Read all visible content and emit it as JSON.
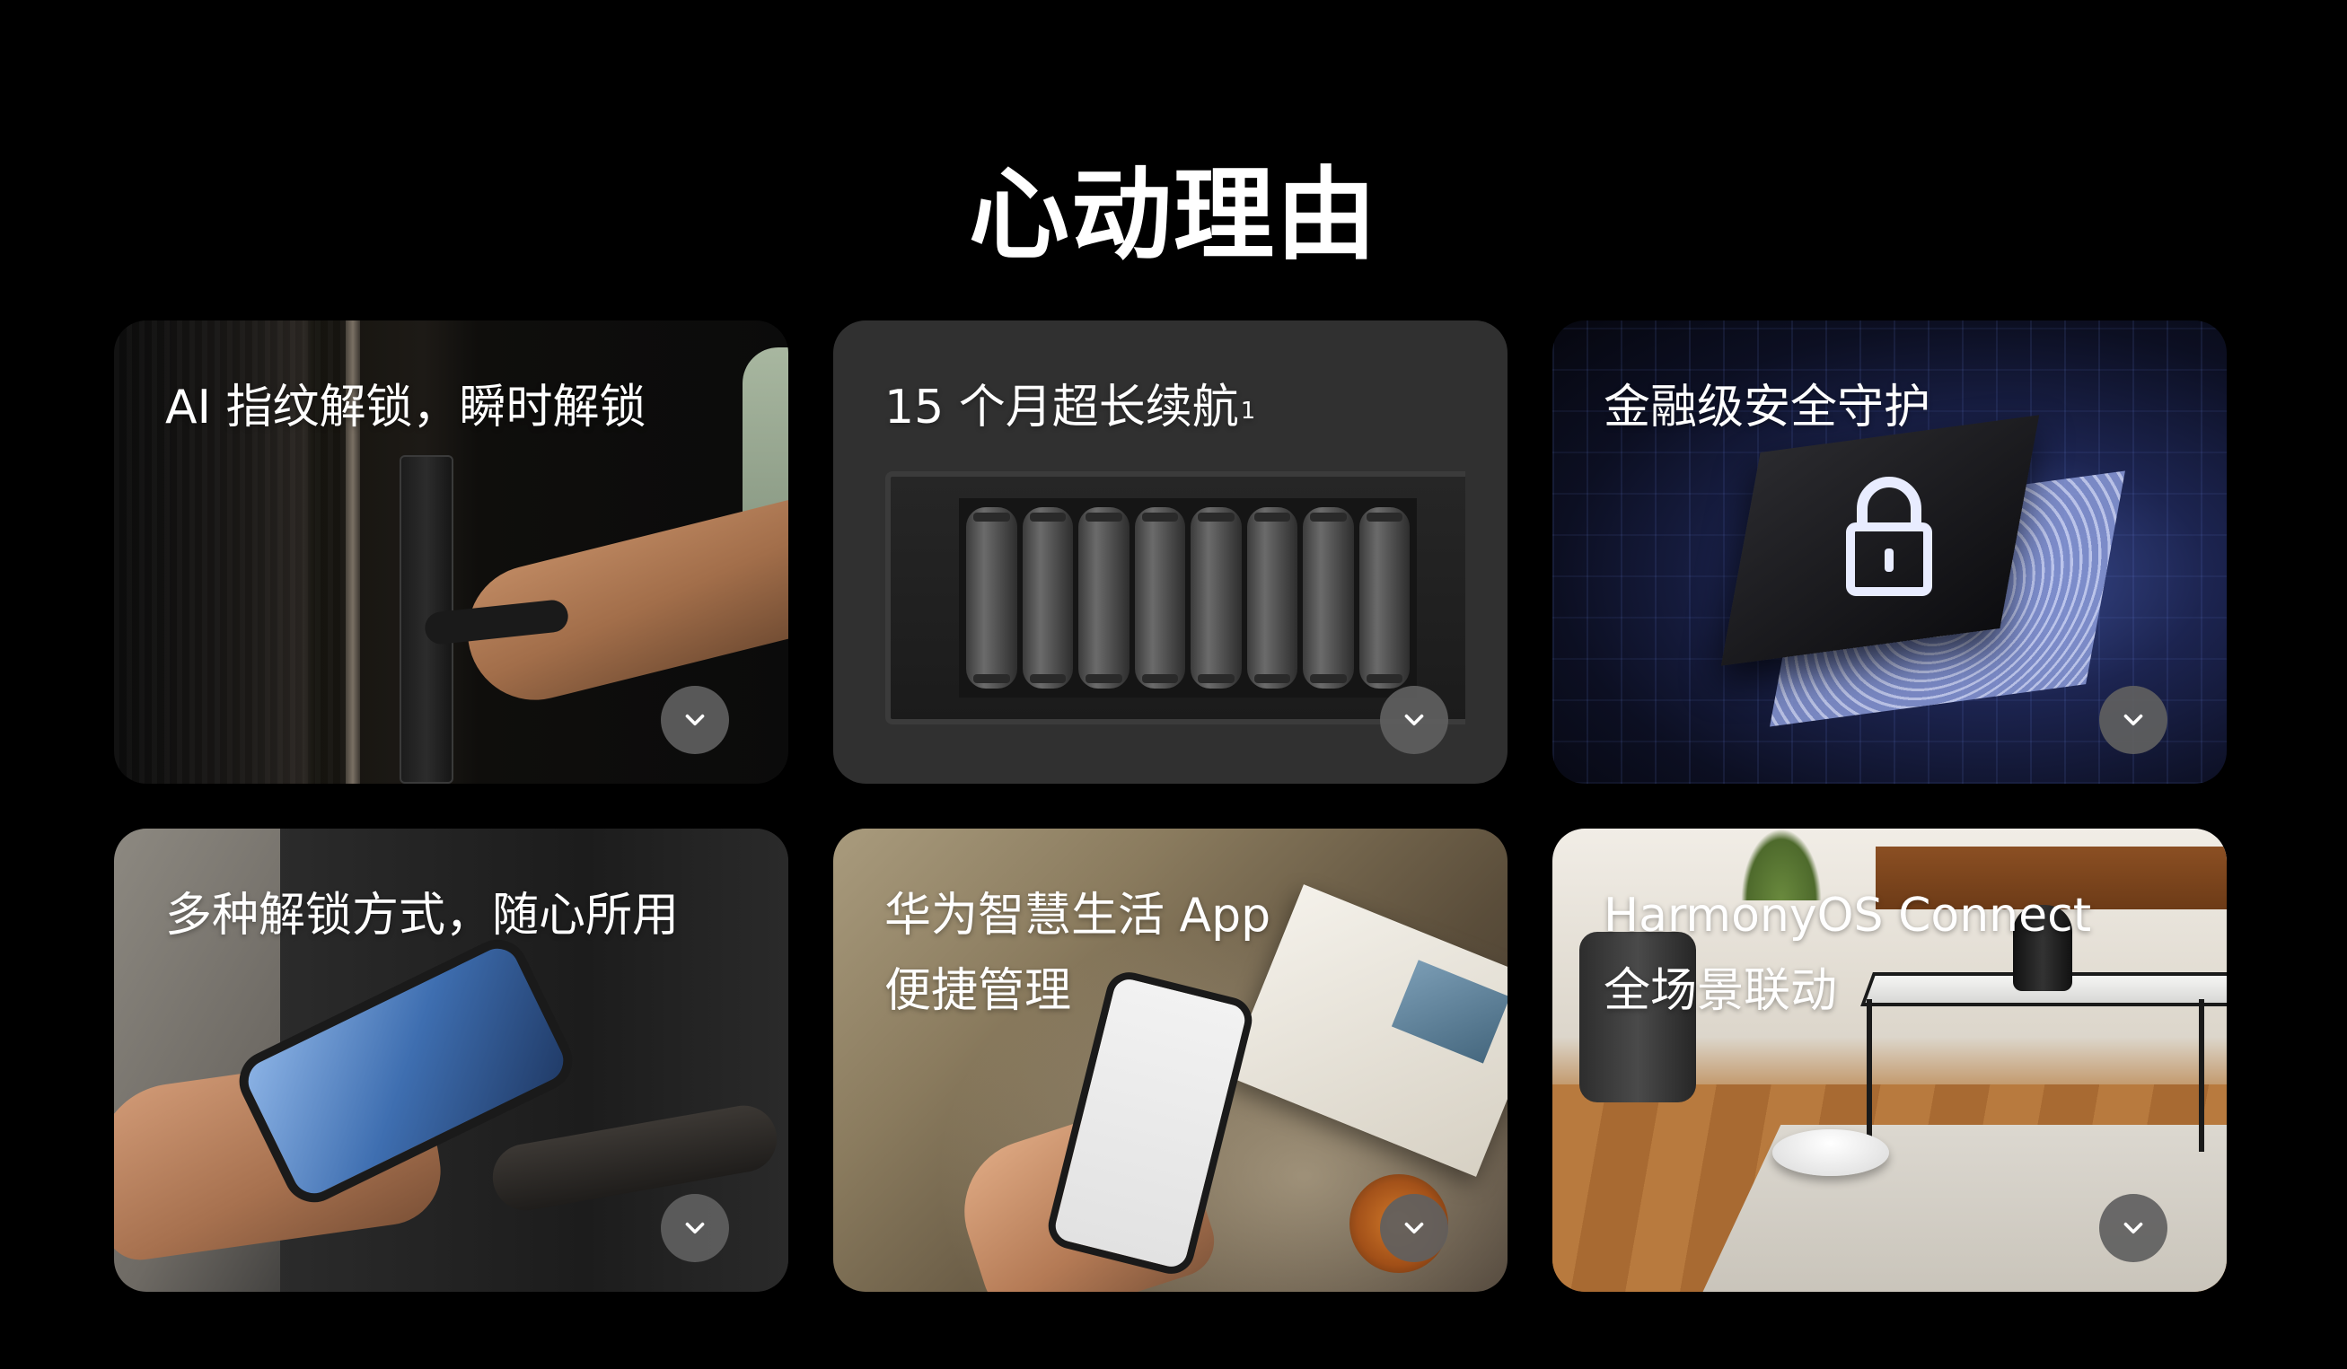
{
  "page": {
    "title": "心动理由"
  },
  "cards": [
    {
      "lines": [
        "AI 指纹解锁，瞬时解锁"
      ],
      "sup": ""
    },
    {
      "lines": [
        "15 个月超长续航"
      ],
      "sup": "1"
    },
    {
      "lines": [
        "金融级安全守护"
      ],
      "sup": ""
    },
    {
      "lines": [
        "多种解锁方式，随心所用"
      ],
      "sup": ""
    },
    {
      "lines": [
        "华为智慧生活 App",
        "便捷管理"
      ],
      "sup": ""
    },
    {
      "lines": [
        "HarmonyOS Connect",
        "全场景联动"
      ],
      "sup": ""
    }
  ],
  "icons": {
    "expand": "chevron-down-icon",
    "lock": "padlock-icon"
  },
  "colors": {
    "background": "#000000",
    "text": "#ffffff",
    "expand_button": "#5f5f5f"
  }
}
